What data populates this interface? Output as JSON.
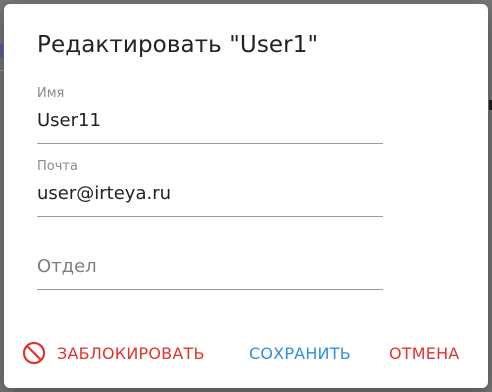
{
  "dialog": {
    "title": "Редактировать \"User1\"",
    "fields": {
      "name": {
        "label": "Имя",
        "value": "User11"
      },
      "email": {
        "label": "Почта",
        "value": "user@irteya.ru"
      },
      "department": {
        "placeholder": "Отдел",
        "value": ""
      }
    },
    "actions": {
      "block_label": "ЗАБЛОКИРОВАТЬ",
      "save_label": "СОХРАНИТЬ",
      "cancel_label": "ОТМЕНА"
    },
    "icons": {
      "block": "block-icon"
    },
    "colors": {
      "danger": "#e0342f",
      "primary": "#2f8fe0"
    }
  }
}
